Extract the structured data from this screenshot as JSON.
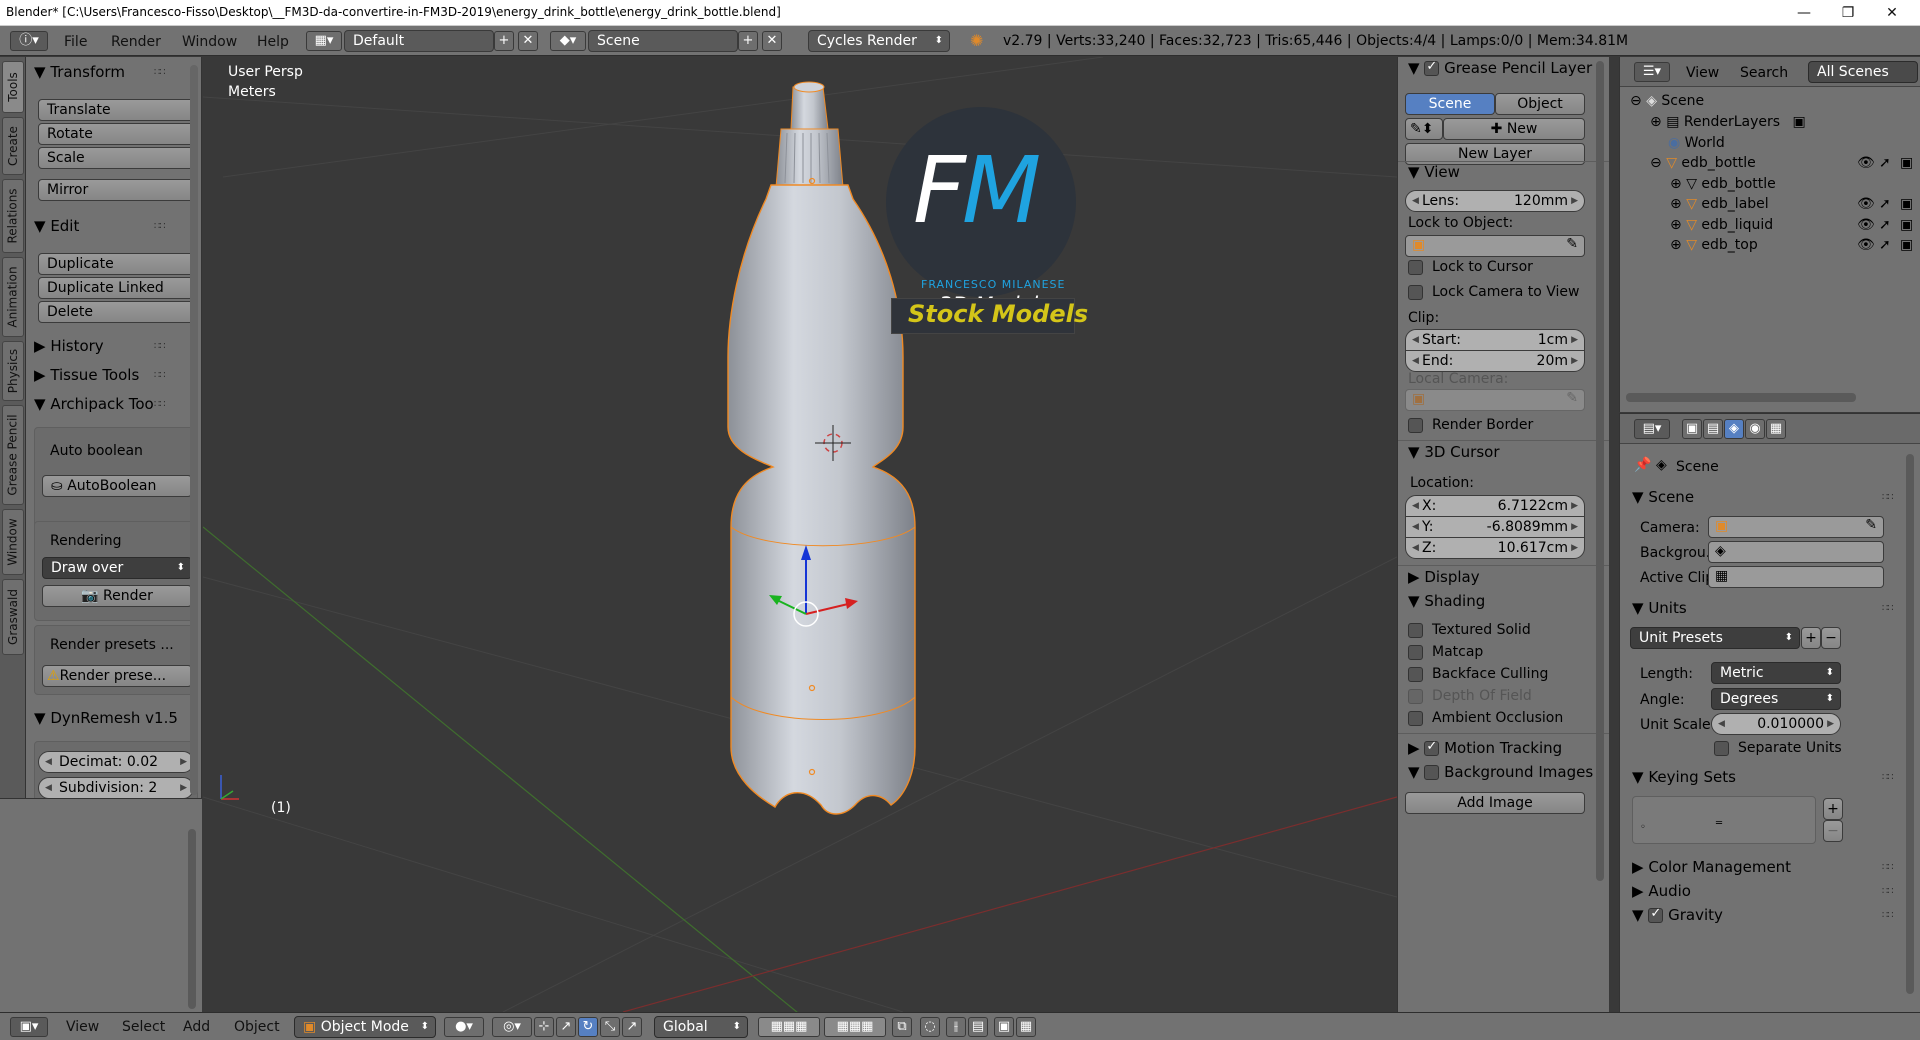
{
  "window": {
    "title": "Blender* [C:\\Users\\Francesco-Fisso\\Desktop\\__FM3D-da-convertire-in-FM3D-2019\\energy_drink_bottle\\energy_drink_bottle.blend]"
  },
  "info": {
    "menus": [
      "File",
      "Render",
      "Window",
      "Help"
    ],
    "layout": "Default",
    "scene": "Scene",
    "engine": "Cycles Render",
    "stats": "v2.79 | Verts:33,240 | Faces:32,723 | Tris:65,446 | Objects:4/4 | Lamps:0/0 | Mem:34.81M"
  },
  "left_tabs": [
    "Tools",
    "Create",
    "Relations",
    "Animation",
    "Physics",
    "Grease Pencil",
    "Window",
    "Graswald"
  ],
  "tools": {
    "transform": "Transform",
    "translate": "Translate",
    "rotate": "Rotate",
    "scale": "Scale",
    "mirror": "Mirror",
    "edit": "Edit",
    "duplicate": "Duplicate",
    "duplicate_linked": "Duplicate Linked",
    "delete": "Delete",
    "history": "History",
    "tissue": "Tissue Tools",
    "archipack": "Archipack Too",
    "auto_boolean_label": "Auto boolean",
    "auto_boolean_btn": "AutoBoolean",
    "rendering_label": "Rendering",
    "draw_over": "Draw over",
    "render_btn": "Render",
    "render_presets": "Render presets ...",
    "render_presets_warn": "Render prese...",
    "dynremesh": "DynRemesh v1.5",
    "decimat": "Decimat: 0.02",
    "subdivision": "Subdivision: 2"
  },
  "viewport": {
    "view_name": "User Persp",
    "units": "Meters",
    "frame": "(1)"
  },
  "watermark": {
    "fm": "FM",
    "author": "FRANCESCO MILANESE",
    "models": "3D Models",
    "stock": "Stock Models"
  },
  "props": {
    "grease_header": "Grease Pencil Layer",
    "tab_scene": "Scene",
    "tab_object": "Object",
    "new_btn": "New",
    "new_layer": "New Layer",
    "view_header": "View",
    "lens_label": "Lens:",
    "lens_value": "120mm",
    "lock_to_object": "Lock to Object:",
    "lock_to_cursor": "Lock to Cursor",
    "lock_camera": "Lock Camera to View",
    "clip": "Clip:",
    "start_label": "Start:",
    "start_value": "1cm",
    "end_label": "End:",
    "end_value": "20m",
    "local_camera": "Local Camera:",
    "render_border": "Render Border",
    "cursor_header": "3D Cursor",
    "location": "Location:",
    "x_label": "X:",
    "x_value": "6.7122cm",
    "y_label": "Y:",
    "y_value": "-6.8089mm",
    "z_label": "Z:",
    "z_value": "10.617cm",
    "display_header": "Display",
    "shading_header": "Shading",
    "textured_solid": "Textured Solid",
    "matcap": "Matcap",
    "backface": "Backface Culling",
    "dof": "Depth Of Field",
    "ao": "Ambient Occlusion",
    "motion_tracking": "Motion Tracking",
    "background_images": "Background Images",
    "add_image": "Add Image"
  },
  "outliner": {
    "view": "View",
    "search": "Search",
    "all_scenes": "All Scenes",
    "items": [
      "Scene",
      "RenderLayers",
      "World",
      "edb_bottle",
      "edb_bottle",
      "edb_label",
      "edb_liquid",
      "edb_top"
    ]
  },
  "scene_props": {
    "scene_title": "Scene",
    "scene_header": "Scene",
    "camera": "Camera:",
    "background": "Backgrou...",
    "active_clip": "Active Clip:",
    "units_header": "Units",
    "unit_presets": "Unit Presets",
    "length_label": "Length:",
    "length_value": "Metric",
    "angle_label": "Angle:",
    "angle_value": "Degrees",
    "unit_scale_label": "Unit Scale:",
    "unit_scale_value": "0.010000",
    "separate_units": "Separate Units",
    "keying_header": "Keying Sets",
    "color_mgmt": "Color Management",
    "audio": "Audio",
    "gravity": "Gravity"
  },
  "bottom": {
    "menus": [
      "View",
      "Select",
      "Add",
      "Object"
    ],
    "mode": "Object Mode",
    "orientation": "Global"
  },
  "colors": {
    "accent": "#5680c2",
    "selection_orange": "#f08a24",
    "viewport_bg": "#393939",
    "panel_bg": "#727272",
    "fm_blue": "#1fa3e0",
    "stock_yellow": "#d4c519"
  }
}
